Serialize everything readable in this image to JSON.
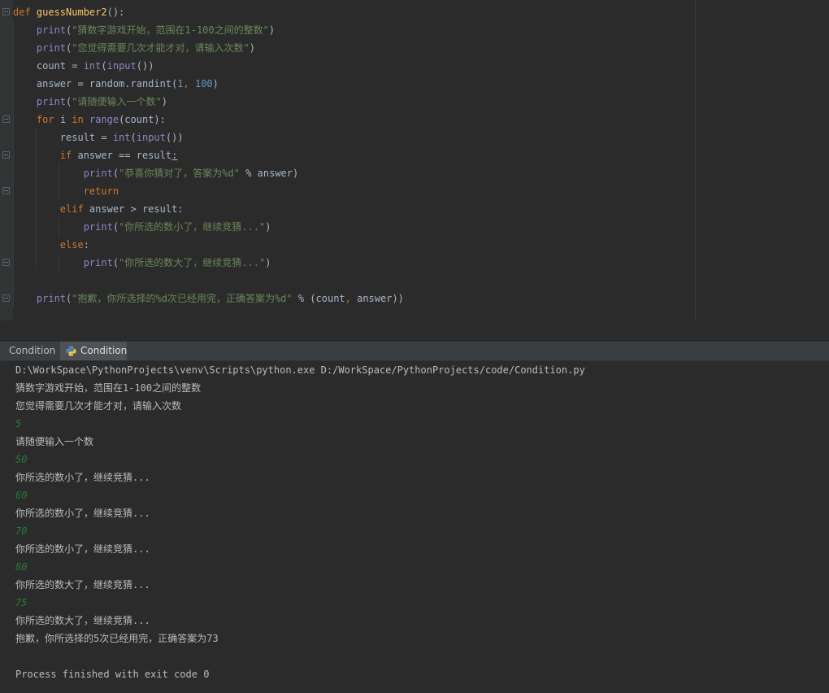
{
  "editor": {
    "lines": [
      [
        {
          "c": "kw",
          "t": "def "
        },
        {
          "c": "fn",
          "t": "guessNumber2"
        },
        {
          "c": "",
          "t": "():"
        }
      ],
      [
        {
          "c": "",
          "t": "    "
        },
        {
          "c": "bi",
          "t": "print"
        },
        {
          "c": "",
          "t": "("
        },
        {
          "c": "str",
          "t": "\"猜数字游戏开始，范围在1-100之间的整数\""
        },
        {
          "c": "",
          "t": ")"
        }
      ],
      [
        {
          "c": "",
          "t": "    "
        },
        {
          "c": "bi",
          "t": "print"
        },
        {
          "c": "",
          "t": "("
        },
        {
          "c": "str",
          "t": "\"您觉得需要几次才能才对，请输入次数\""
        },
        {
          "c": "",
          "t": ")"
        }
      ],
      [
        {
          "c": "",
          "t": "    count = "
        },
        {
          "c": "bi",
          "t": "int"
        },
        {
          "c": "",
          "t": "("
        },
        {
          "c": "bi",
          "t": "input"
        },
        {
          "c": "",
          "t": "())"
        }
      ],
      [
        {
          "c": "",
          "t": "    answer = random.randint("
        },
        {
          "c": "num",
          "t": "1"
        },
        {
          "c": "kw",
          "t": ", "
        },
        {
          "c": "num",
          "t": "100"
        },
        {
          "c": "",
          "t": ")"
        }
      ],
      [
        {
          "c": "",
          "t": "    "
        },
        {
          "c": "bi",
          "t": "print"
        },
        {
          "c": "",
          "t": "("
        },
        {
          "c": "str",
          "t": "\"请随便输入一个数\""
        },
        {
          "c": "",
          "t": ")"
        }
      ],
      [
        {
          "c": "",
          "t": "    "
        },
        {
          "c": "kw",
          "t": "for "
        },
        {
          "c": "",
          "t": "i "
        },
        {
          "c": "kw",
          "t": "in "
        },
        {
          "c": "bi",
          "t": "range"
        },
        {
          "c": "",
          "t": "(count):"
        }
      ],
      [
        {
          "c": "",
          "t": "        result = "
        },
        {
          "c": "bi",
          "t": "int"
        },
        {
          "c": "",
          "t": "("
        },
        {
          "c": "bi",
          "t": "input"
        },
        {
          "c": "",
          "t": "())"
        }
      ],
      [
        {
          "c": "",
          "t": "        "
        },
        {
          "c": "kw",
          "t": "if "
        },
        {
          "c": "",
          "t": "answer == result"
        },
        {
          "c": "und",
          "t": ":"
        }
      ],
      [
        {
          "c": "",
          "t": "            "
        },
        {
          "c": "bi",
          "t": "print"
        },
        {
          "c": "",
          "t": "("
        },
        {
          "c": "str",
          "t": "\"恭喜你猜对了，答案为%d\""
        },
        {
          "c": "",
          "t": " % answer)"
        }
      ],
      [
        {
          "c": "",
          "t": "            "
        },
        {
          "c": "kw",
          "t": "return"
        }
      ],
      [
        {
          "c": "",
          "t": "        "
        },
        {
          "c": "kw",
          "t": "elif "
        },
        {
          "c": "",
          "t": "answer > result:"
        }
      ],
      [
        {
          "c": "",
          "t": "            "
        },
        {
          "c": "bi",
          "t": "print"
        },
        {
          "c": "",
          "t": "("
        },
        {
          "c": "str",
          "t": "\"你所选的数小了，继续竞猜...\""
        },
        {
          "c": "",
          "t": ")"
        }
      ],
      [
        {
          "c": "",
          "t": "        "
        },
        {
          "c": "kw",
          "t": "else"
        },
        {
          "c": "",
          "t": ":"
        }
      ],
      [
        {
          "c": "",
          "t": "            "
        },
        {
          "c": "bi",
          "t": "print"
        },
        {
          "c": "",
          "t": "("
        },
        {
          "c": "str",
          "t": "\"你所选的数大了，继续竞猜...\""
        },
        {
          "c": "",
          "t": ")"
        }
      ],
      [],
      [
        {
          "c": "",
          "t": "    "
        },
        {
          "c": "bi",
          "t": "print"
        },
        {
          "c": "",
          "t": "("
        },
        {
          "c": "str",
          "t": "\"抱歉，你所选择的%d次已经用完，正确答案为%d\""
        },
        {
          "c": "",
          "t": " % (count"
        },
        {
          "c": "kw",
          "t": ", "
        },
        {
          "c": "",
          "t": "answer))"
        }
      ]
    ]
  },
  "run_panel": {
    "tabs": [
      {
        "label": "Condition",
        "active": false
      },
      {
        "label": "Condition",
        "active": true
      }
    ],
    "console_lines": [
      {
        "type": "out",
        "text": "D:\\WorkSpace\\PythonProjects\\venv\\Scripts\\python.exe D:/WorkSpace/PythonProjects/code/Condition.py"
      },
      {
        "type": "out",
        "text": "猜数字游戏开始，范围在1-100之间的整数"
      },
      {
        "type": "out",
        "text": "您觉得需要几次才能才对，请输入次数"
      },
      {
        "type": "in",
        "text": "5"
      },
      {
        "type": "out",
        "text": "请随便输入一个数"
      },
      {
        "type": "in",
        "text": "50"
      },
      {
        "type": "out",
        "text": "你所选的数小了，继续竞猜..."
      },
      {
        "type": "in",
        "text": "60"
      },
      {
        "type": "out",
        "text": "你所选的数小了，继续竞猜..."
      },
      {
        "type": "in",
        "text": "70"
      },
      {
        "type": "out",
        "text": "你所选的数小了，继续竞猜..."
      },
      {
        "type": "in",
        "text": "80"
      },
      {
        "type": "out",
        "text": "你所选的数大了，继续竞猜..."
      },
      {
        "type": "in",
        "text": "75"
      },
      {
        "type": "out",
        "text": "你所选的数大了，继续竞猜..."
      },
      {
        "type": "out",
        "text": "抱歉，你所选择的5次已经用完，正确答案为73"
      },
      {
        "type": "blank",
        "text": ""
      },
      {
        "type": "out",
        "text": "Process finished with exit code 0"
      }
    ]
  },
  "colors": {
    "editor_bg": "#2b2b2b",
    "keyword": "#cc7832",
    "function": "#ffc66d",
    "builtin": "#8888c6",
    "string": "#6a8759",
    "number": "#6897bb",
    "console_input": "#287b36"
  },
  "icons": {
    "tab_icon": "python-icon",
    "gutter": "fold-marker-icon"
  }
}
